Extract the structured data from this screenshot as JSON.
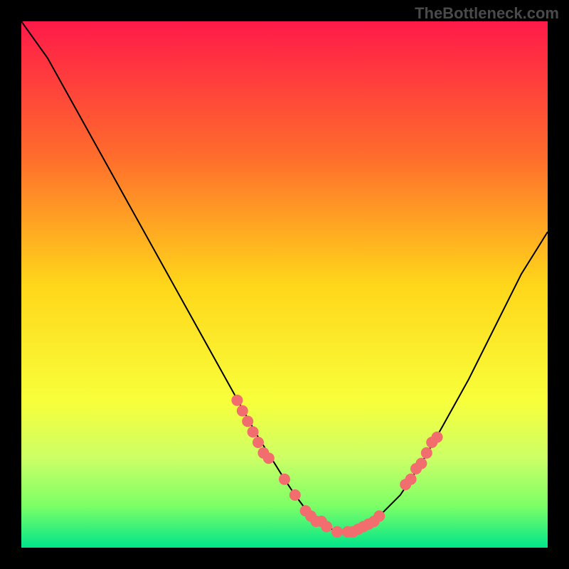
{
  "watermark": "TheBottleneck.com",
  "chart_data": {
    "type": "line",
    "title": "",
    "xlabel": "",
    "ylabel": "",
    "xlim": [
      0,
      100
    ],
    "ylim": [
      0,
      100
    ],
    "background": {
      "type": "vertical-gradient",
      "stops": [
        {
          "offset": 0,
          "color": "#ff1a49"
        },
        {
          "offset": 25,
          "color": "#ff6a2d"
        },
        {
          "offset": 50,
          "color": "#ffd61a"
        },
        {
          "offset": 72,
          "color": "#f8ff3a"
        },
        {
          "offset": 83,
          "color": "#ccff66"
        },
        {
          "offset": 92,
          "color": "#7dff66"
        },
        {
          "offset": 100,
          "color": "#00e58a"
        }
      ]
    },
    "series": [
      {
        "name": "bottleneck-curve",
        "color": "#000000",
        "x": [
          0,
          5,
          10,
          15,
          20,
          25,
          30,
          35,
          40,
          45,
          50,
          52,
          55,
          58,
          60,
          63,
          65,
          68,
          72,
          76,
          80,
          85,
          90,
          95,
          100
        ],
        "values": [
          100,
          93,
          84,
          75,
          66,
          57,
          48,
          39,
          30,
          21,
          13,
          10,
          6,
          4,
          3,
          3,
          4,
          6,
          10,
          16,
          23,
          32,
          42,
          52,
          60
        ]
      }
    ],
    "marker_points": {
      "name": "marker-dots",
      "color": "#f26d6d",
      "radius": 8,
      "points": [
        {
          "x": 41,
          "y": 28
        },
        {
          "x": 42,
          "y": 26
        },
        {
          "x": 43,
          "y": 24
        },
        {
          "x": 44,
          "y": 22
        },
        {
          "x": 45,
          "y": 20
        },
        {
          "x": 46,
          "y": 18
        },
        {
          "x": 47,
          "y": 17
        },
        {
          "x": 50,
          "y": 13
        },
        {
          "x": 52,
          "y": 10
        },
        {
          "x": 54,
          "y": 7
        },
        {
          "x": 55,
          "y": 6
        },
        {
          "x": 56,
          "y": 5
        },
        {
          "x": 57,
          "y": 5
        },
        {
          "x": 58,
          "y": 4
        },
        {
          "x": 60,
          "y": 3
        },
        {
          "x": 62,
          "y": 3
        },
        {
          "x": 63,
          "y": 3
        },
        {
          "x": 64,
          "y": 3.5
        },
        {
          "x": 65,
          "y": 4
        },
        {
          "x": 66,
          "y": 4.5
        },
        {
          "x": 67,
          "y": 5
        },
        {
          "x": 68,
          "y": 6
        },
        {
          "x": 73,
          "y": 12
        },
        {
          "x": 74,
          "y": 13
        },
        {
          "x": 75,
          "y": 15
        },
        {
          "x": 76,
          "y": 16
        },
        {
          "x": 77,
          "y": 18
        },
        {
          "x": 78,
          "y": 20
        },
        {
          "x": 79,
          "y": 21
        }
      ]
    },
    "grid": false,
    "legend": "none"
  }
}
